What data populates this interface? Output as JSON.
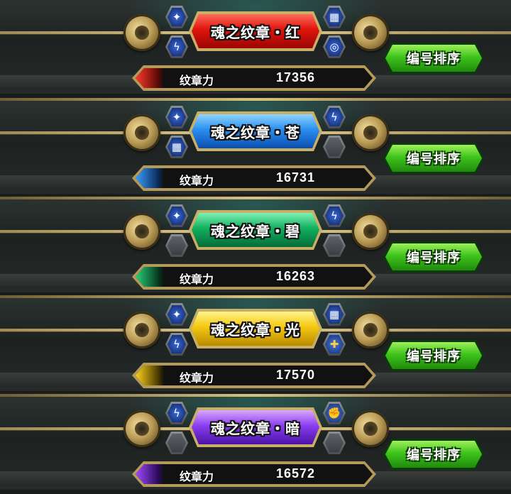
{
  "power_label": "纹章力",
  "sort_label": "编号排序",
  "emblems": [
    {
      "name": "魂之纹章・红",
      "power": "17356",
      "color": "#e0140e",
      "slots": [
        {
          "icon": "dark-element-icon",
          "kind": "blue",
          "glyph": "✦"
        },
        {
          "icon": "lightning-icon",
          "kind": "blue",
          "glyph": "ϟ"
        },
        {
          "icon": "shield-grid-icon",
          "kind": "blue",
          "glyph": "▦"
        },
        {
          "icon": "swirl-icon",
          "kind": "blue",
          "glyph": "◎"
        }
      ]
    },
    {
      "name": "魂之纹章・苍",
      "power": "16731",
      "color": "#2a8ef0",
      "slots": [
        {
          "icon": "dark-element-icon",
          "kind": "blue",
          "glyph": "✦"
        },
        {
          "icon": "shield-grid-icon",
          "kind": "blue",
          "glyph": "▦"
        },
        {
          "icon": "lightning-icon",
          "kind": "blue",
          "glyph": "ϟ"
        },
        {
          "icon": "empty-slot-icon",
          "kind": "empty",
          "glyph": ""
        }
      ]
    },
    {
      "name": "魂之纹章・碧",
      "power": "16263",
      "color": "#12b05e",
      "slots": [
        {
          "icon": "dark-element-icon",
          "kind": "blue",
          "glyph": "✦"
        },
        {
          "icon": "empty-slot-icon",
          "kind": "empty",
          "glyph": ""
        },
        {
          "icon": "lightning-icon",
          "kind": "blue",
          "glyph": "ϟ"
        },
        {
          "icon": "empty-slot-icon",
          "kind": "empty",
          "glyph": ""
        }
      ]
    },
    {
      "name": "魂之纹章・光",
      "power": "17570",
      "color": "#f5c812",
      "slots": [
        {
          "icon": "dark-element-icon",
          "kind": "blue",
          "glyph": "✦"
        },
        {
          "icon": "lightning-icon",
          "kind": "blue",
          "glyph": "ϟ"
        },
        {
          "icon": "shield-grid-icon",
          "kind": "blue",
          "glyph": "▦"
        },
        {
          "icon": "power-up-icon",
          "kind": "gold",
          "glyph": "✚"
        }
      ]
    },
    {
      "name": "魂之纹章・暗",
      "power": "16572",
      "color": "#8a3ef0",
      "slots": [
        {
          "icon": "lightning-icon",
          "kind": "blue",
          "glyph": "ϟ"
        },
        {
          "icon": "empty-slot-icon",
          "kind": "empty",
          "glyph": ""
        },
        {
          "icon": "gauntlet-icon",
          "kind": "gold",
          "glyph": "✊"
        },
        {
          "icon": "empty-slot-icon",
          "kind": "empty",
          "glyph": ""
        }
      ]
    }
  ]
}
